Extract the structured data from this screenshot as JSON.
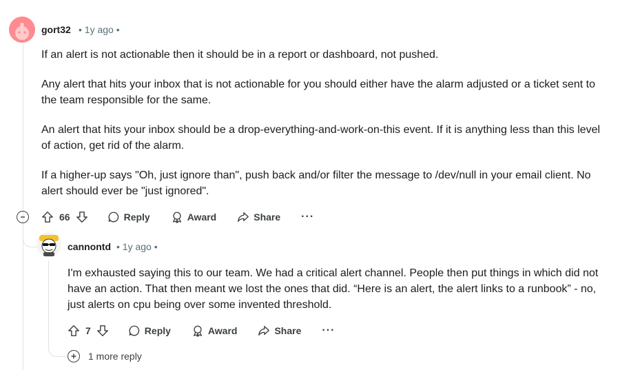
{
  "comment1": {
    "username": "gort32",
    "meta": "• 1y ago •",
    "paragraphs": [
      "If an alert is not actionable then it should be in a report or dashboard, not pushed.",
      "Any alert that hits your inbox that is not actionable for you should either have the alarm adjusted or a ticket sent to the team responsible for the same.",
      "An alert that hits your inbox should be a drop-everything-and-work-on-this event. If it is anything less than this level of action, get rid of the alarm.",
      "If a higher-up says \"Oh, just ignore than\", push back and/or filter the message to /dev/null in your email client. No alert should ever be \"just ignored\"."
    ],
    "score": "66",
    "actions": {
      "reply": "Reply",
      "award": "Award",
      "share": "Share",
      "more": "···"
    }
  },
  "comment2": {
    "username": "cannontd",
    "meta": "• 1y ago •",
    "paragraphs": [
      "I'm exhausted saying this to our team. We had a critical alert channel. People then put things in which did not have an action. That then meant we lost the ones that did. “Here is an alert, the alert links to a runbook” - no, just alerts on cpu being over some invented threshold."
    ],
    "score": "7",
    "actions": {
      "reply": "Reply",
      "award": "Award",
      "share": "Share",
      "more": "···"
    }
  },
  "more_replies": "1 more reply",
  "colors": {
    "avatar1_bg": "#ff8a8f",
    "thread_line": "#dfe3e6",
    "meta": "#576f76"
  }
}
